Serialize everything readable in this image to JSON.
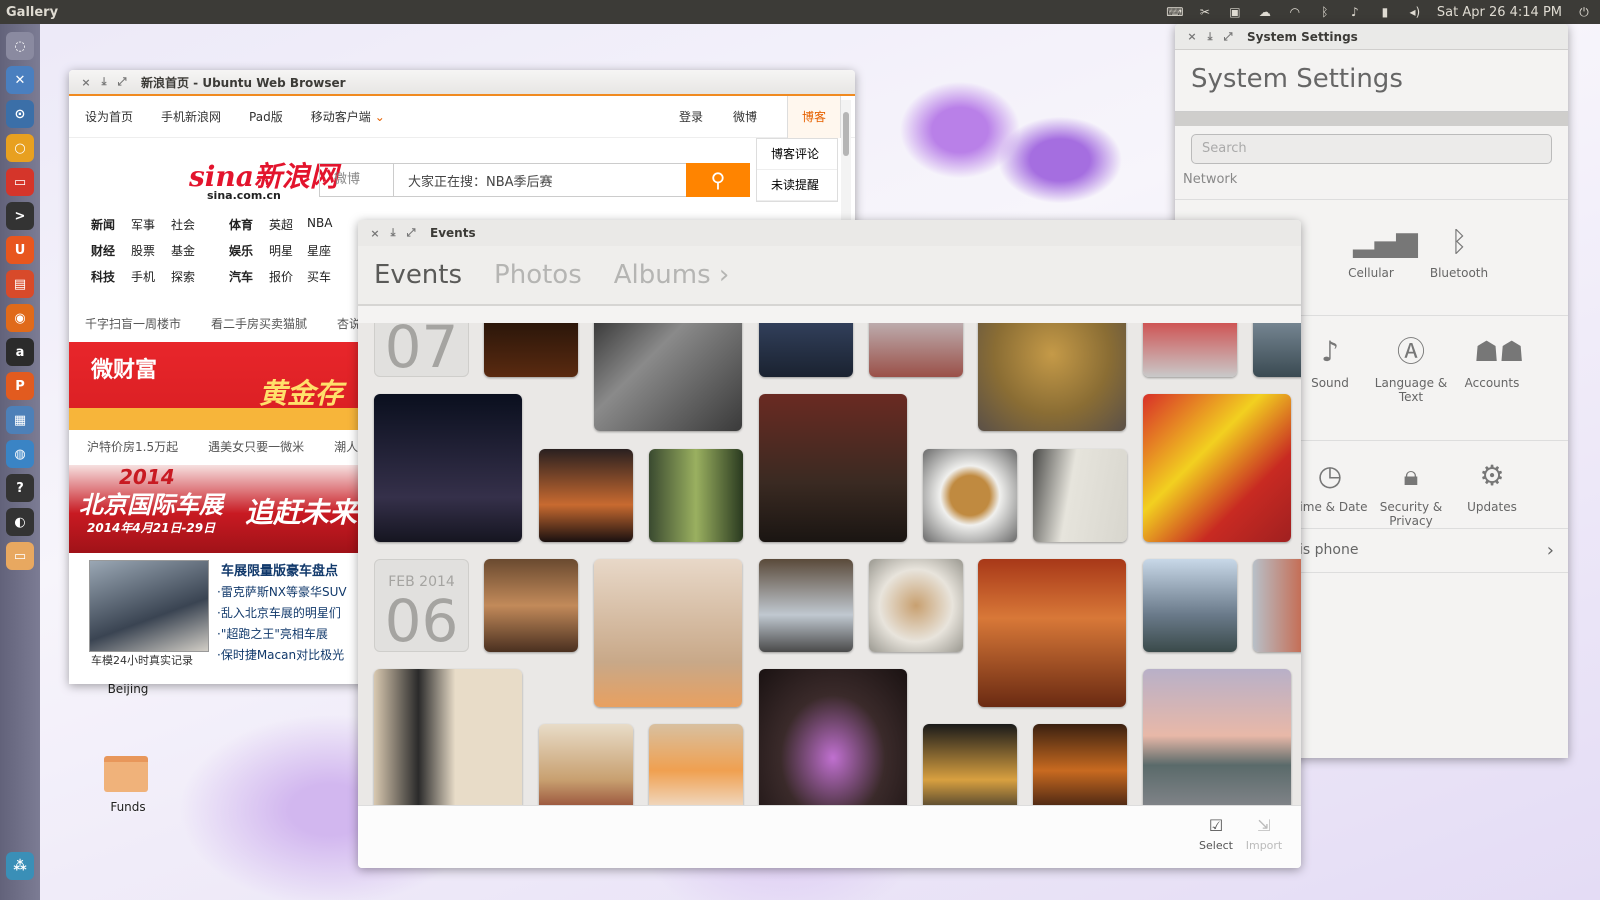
{
  "top_panel": {
    "app_title": "Gallery",
    "clock": "Sat Apr 26  4:14 PM"
  },
  "launcher": {
    "items": [
      "dash-icon",
      "gallery-icon",
      "files-icon",
      "ubuntu-one-icon",
      "software-center-icon",
      "terminal-icon",
      "ubuntu-icon",
      "app-icon",
      "firefox-icon",
      "amazon-icon",
      "impress-icon",
      "shotwell-icon",
      "globe-icon",
      "help-icon",
      "toggle-icon",
      "folder-icon",
      "workspace-icon"
    ]
  },
  "browser": {
    "title": "新浪首页 - Ubuntu Web Browser",
    "nav": [
      "设为首页",
      "手机新浪网",
      "Pad版",
      "移动客户端"
    ],
    "nav_right": [
      "登录",
      "微博",
      "博客"
    ],
    "blog_menu": [
      "博客评论",
      "未读提醒"
    ],
    "logo": "sina新浪网",
    "logo_sub": "sina.com.cn",
    "search_select": "微博",
    "search_value": "大家正在搜：NBA季后赛",
    "categories": [
      [
        "新闻",
        "军事",
        "社会",
        "体育",
        "英超",
        "NBA"
      ],
      [
        "财经",
        "股票",
        "基金",
        "娱乐",
        "明星",
        "星座"
      ],
      [
        "科技",
        "手机",
        "探索",
        "汽车",
        "报价",
        "买车"
      ]
    ],
    "promo1": [
      "千字扫盲一周楼市",
      "看二手房买卖猫腻",
      "杏说"
    ],
    "ad1_left": "微财富",
    "ad1_right": "黄金存",
    "promo2": [
      "沪特价房1.5万起",
      "遇美女只要一微米",
      "潮人"
    ],
    "ad2_year": "2014",
    "ad2_title": "北京国际车展",
    "ad2_date": "2014年4月21日-29日",
    "ad2_right": "追赶未来",
    "news_head": "车展限量版豪车盘点",
    "news_items": [
      "·雷克萨斯NX等豪华SUV",
      "·乱入北京车展的明星们",
      "·\"超跑之王\"亮相车展",
      "·保时捷Macan对比极光"
    ],
    "news_caption": "车模24小时真实记录"
  },
  "settings": {
    "title": "System Settings",
    "heading": "System Settings",
    "search_placeholder": "Search",
    "section_network": "Network",
    "items": {
      "cellular": "Cellular",
      "bluetooth": "Bluetooth",
      "sound": "Sound",
      "language": "Language & Text",
      "accounts": "Accounts",
      "time": "Time & Date",
      "security": "Security & Privacy",
      "updates": "Updates"
    },
    "phone_row": "is phone"
  },
  "gallery": {
    "title": "Events",
    "tabs": [
      "Events",
      "Photos",
      "Albums ›"
    ],
    "date1_day": "07",
    "date2_month": "FEB 2014",
    "date2_day": "06",
    "select_label": "Select",
    "import_label": "Import"
  },
  "desktop": {
    "beijing_label": "Beijing",
    "funds_label": "Funds"
  }
}
